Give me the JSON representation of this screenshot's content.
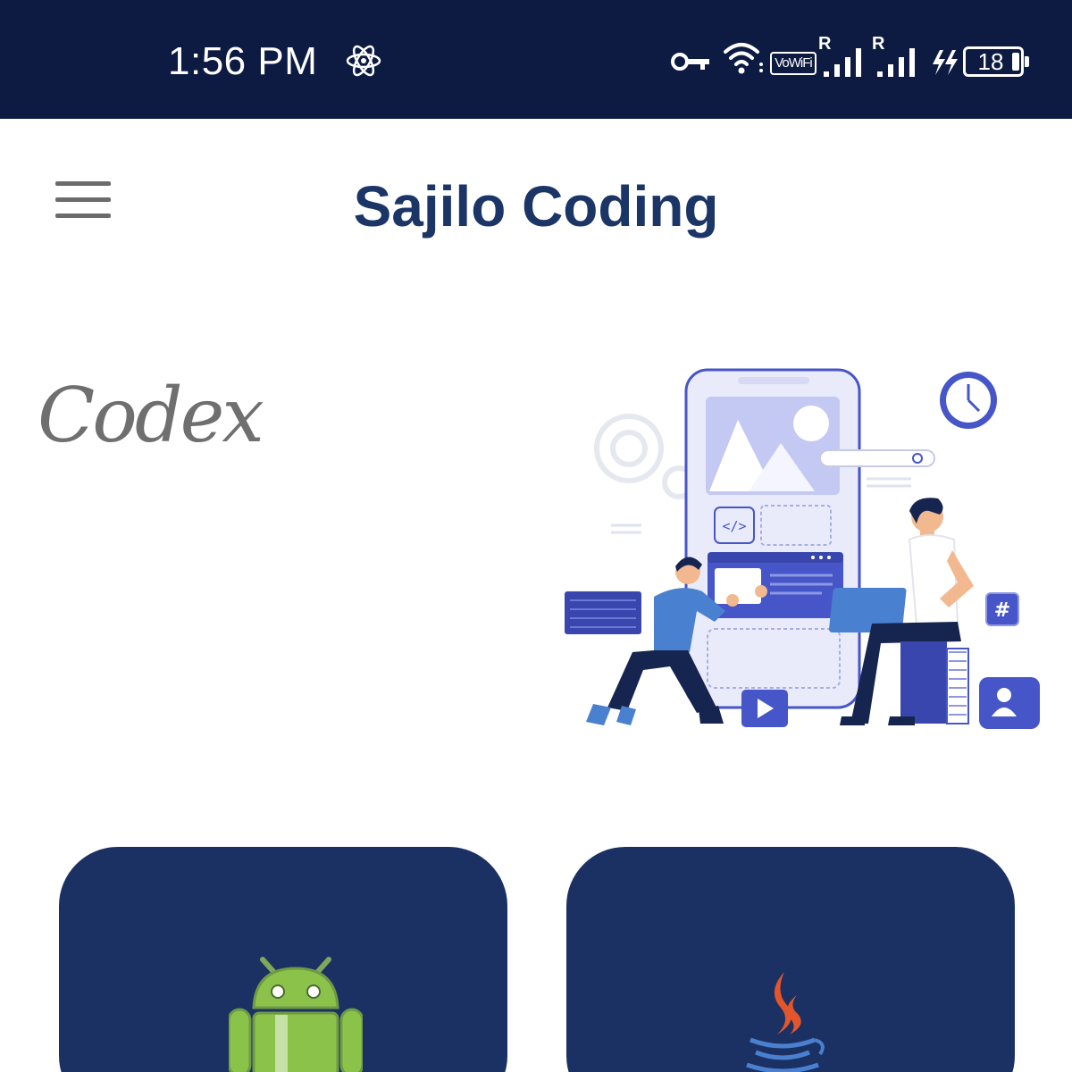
{
  "status_bar": {
    "time": "1:56 PM",
    "vowifi": "VoWiFi",
    "roaming_1": "R",
    "roaming_2": "R",
    "battery": "18",
    "icons": [
      "atom-icon",
      "vpn-key-icon",
      "wifi-icon",
      "signal-icon",
      "charging-icon",
      "battery-icon"
    ]
  },
  "app_bar": {
    "title": "Sajilo Coding",
    "menu_icon": "hamburger-menu-icon"
  },
  "hero": {
    "logo_text": "Codex",
    "illustration": "developers-building-mobile-app-illustration"
  },
  "cards": [
    {
      "icon": "android-icon",
      "accent": "#8bc34a"
    },
    {
      "icon": "java-icon",
      "accent": "#e3562b"
    }
  ],
  "colors": {
    "status_bar_bg": "#0d1b42",
    "title": "#1b3566",
    "card_bg": "#1c3163",
    "illustration_primary": "#4656c8"
  }
}
